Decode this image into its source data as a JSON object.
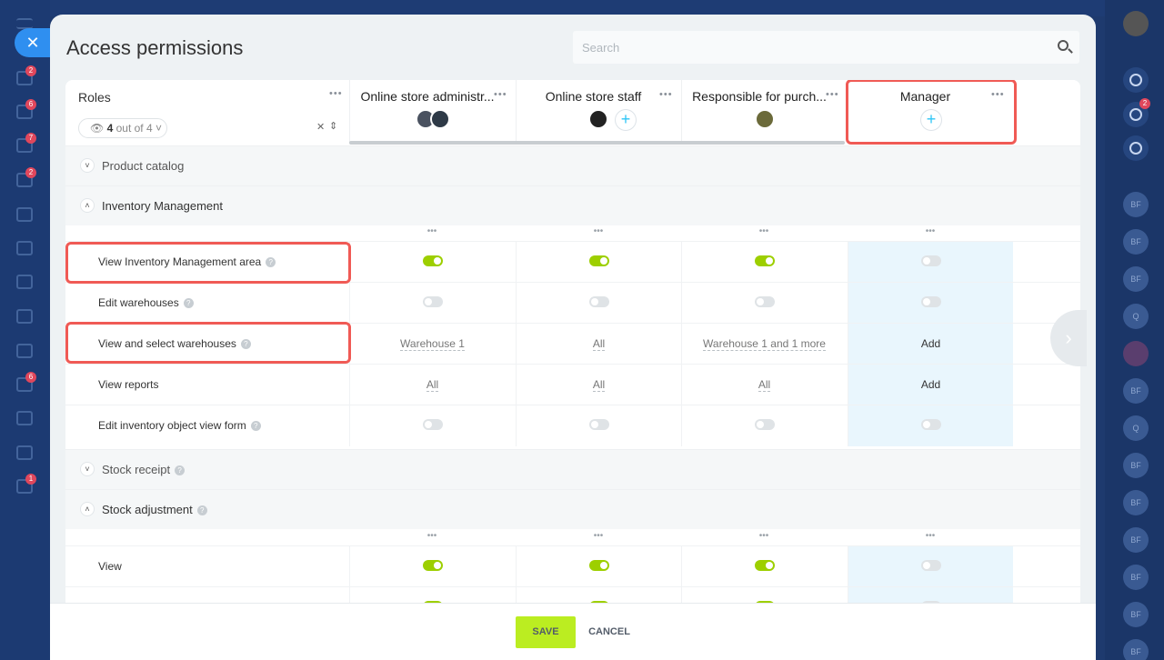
{
  "window": {
    "title": "Access permissions",
    "search_placeholder": "Search"
  },
  "left_nav": {
    "badges": [
      "2",
      "6",
      "7",
      "2",
      "6",
      "1"
    ]
  },
  "right_bar": {
    "badge": "2",
    "avatars": [
      "BF",
      "BF",
      "BF",
      "Q",
      "BF",
      "Q",
      "BF",
      "BF",
      "BF",
      "BF",
      "BF",
      "BF",
      "BF"
    ]
  },
  "roles": {
    "label": "Roles",
    "visible_count": "4",
    "visible_of": "out of 4"
  },
  "columns": [
    {
      "label": "Online store administr...",
      "has_plus": false
    },
    {
      "label": "Online store staff",
      "has_plus": true
    },
    {
      "label": "Responsible for purch...",
      "has_plus": false
    },
    {
      "label": "Manager",
      "has_plus": true
    }
  ],
  "sections": [
    {
      "title": "Product catalog",
      "expanded": false,
      "help": false
    },
    {
      "title": "Inventory Management",
      "expanded": true,
      "rows": [
        {
          "label": "View Inventory Management area",
          "help": true,
          "type": "toggle",
          "values": [
            true,
            true,
            true,
            false
          ]
        },
        {
          "label": "Edit warehouses",
          "help": true,
          "type": "toggle",
          "values": [
            false,
            false,
            false,
            false
          ]
        },
        {
          "label": "View and select warehouses",
          "help": true,
          "type": "text",
          "values": [
            "Warehouse 1",
            "All",
            "Warehouse 1 and 1 more",
            "Add"
          ]
        },
        {
          "label": "View reports",
          "help": false,
          "type": "text",
          "values": [
            "All",
            "All",
            "All",
            "Add"
          ]
        },
        {
          "label": "Edit inventory object view form",
          "help": true,
          "type": "toggle",
          "values": [
            false,
            false,
            false,
            false
          ]
        }
      ]
    },
    {
      "title": "Stock receipt",
      "expanded": false,
      "help": true
    },
    {
      "title": "Stock adjustment",
      "expanded": true,
      "help": true,
      "rows": [
        {
          "label": "View",
          "help": false,
          "type": "toggle",
          "values": [
            true,
            true,
            true,
            false
          ]
        }
      ]
    }
  ],
  "footer": {
    "save": "SAVE",
    "cancel": "CANCEL"
  },
  "colors": {
    "toggle_on": "#9dcf00",
    "highlight": "#e9f6fd",
    "save": "#bbed21",
    "annotation": "#f05a55"
  }
}
